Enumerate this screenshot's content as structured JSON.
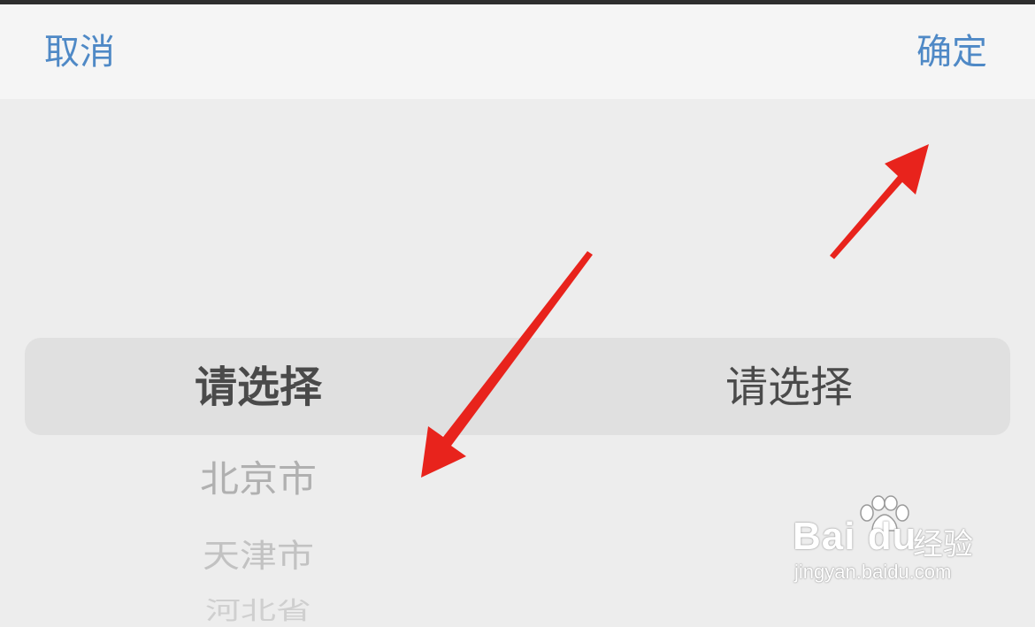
{
  "header": {
    "cancel_label": "取消",
    "confirm_label": "确定"
  },
  "picker": {
    "province_column": {
      "selected": "请选择",
      "items": [
        "北京市",
        "天津市",
        "河北省"
      ]
    },
    "city_column": {
      "selected": "请选择"
    }
  },
  "watermark": {
    "logo_text": "Bai du",
    "logo_cn": "经验",
    "url": "jingyan.baidu.com"
  },
  "colors": {
    "accent": "#4f89c6",
    "annotation_arrow": "#e8231c",
    "background": "#ededed",
    "header_background": "#f5f5f5",
    "selection_band": "#e0e0e0"
  },
  "icons": {
    "annotation": "arrow-icon",
    "watermark": "baidu-paw-icon"
  }
}
